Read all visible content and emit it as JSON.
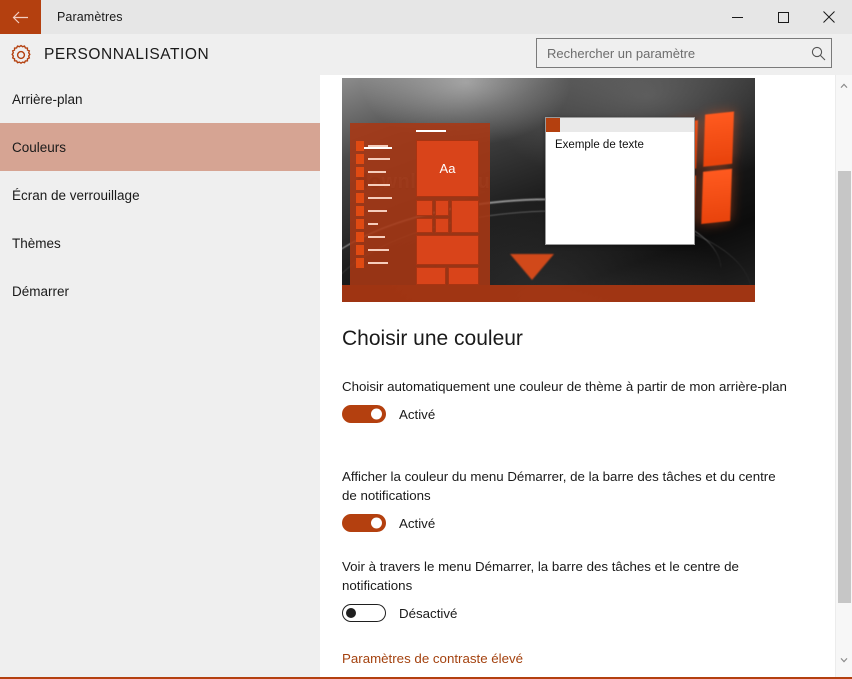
{
  "titlebar": {
    "title": "Paramètres",
    "back_icon": "arrow-left-icon",
    "minimize_label": "—",
    "maximize_label": "▢",
    "close_label": "✕",
    "accent_color": "#b4400f",
    "background_color": "#e6e6e6"
  },
  "header": {
    "icon": "gear-icon",
    "title": "PERSONNALISATION"
  },
  "search": {
    "placeholder": "Rechercher un paramètre",
    "value": "",
    "icon": "search-icon"
  },
  "sidebar": {
    "items": [
      {
        "label": "Arrière-plan",
        "selected": false
      },
      {
        "label": "Couleurs",
        "selected": true
      },
      {
        "label": "Écran de verrouillage",
        "selected": false
      },
      {
        "label": "Thèmes",
        "selected": false
      },
      {
        "label": "Démarrer",
        "selected": false
      }
    ],
    "selected_color": "#d6a493",
    "background_color": "#efefef"
  },
  "preview": {
    "sample_window_text": "Exemple de texte",
    "tile_letters": "Aa",
    "wallpaper_text_light": "wnloadsou",
    "wallpaper_text_dark": "do",
    "accent_color": "#b4400f"
  },
  "main": {
    "section_title": "Choisir une couleur",
    "settings": [
      {
        "label": "Choisir automatiquement une couleur de thème à partir de mon arrière-plan",
        "state": "Activé",
        "on": true
      },
      {
        "label": "Afficher la couleur du menu Démarrer, de la barre des tâches et du centre de notifications",
        "state": "Activé",
        "on": true
      },
      {
        "label": "Voir à travers le menu Démarrer, la barre des tâches et le centre de notifications",
        "state": "Désactivé",
        "on": false
      }
    ],
    "link": "Paramètres de contraste élevé",
    "link_color": "#a4420f"
  },
  "scrollbar": {
    "up_icon": "chevron-up-icon",
    "down_icon": "chevron-down-icon"
  }
}
